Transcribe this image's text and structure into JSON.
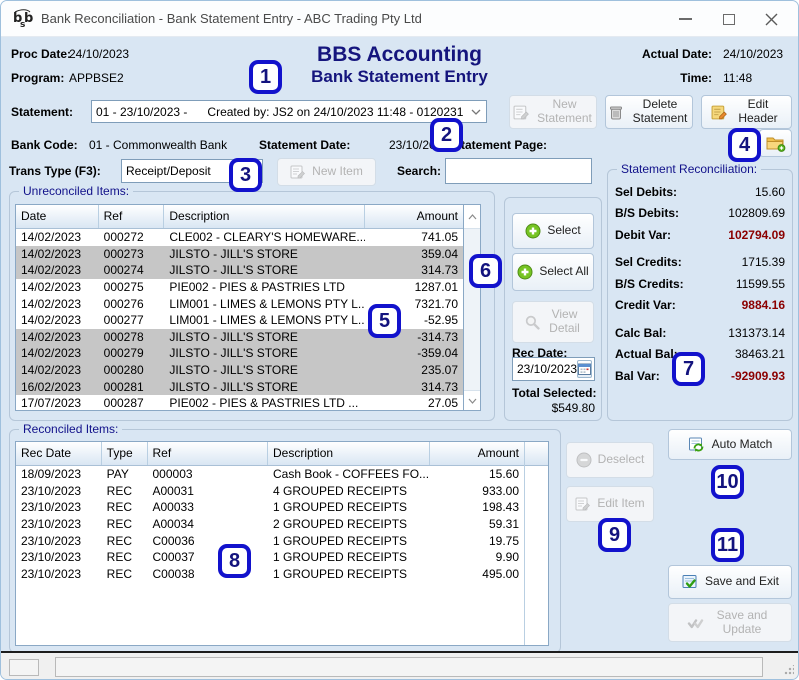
{
  "colors": {
    "accent_navy": "#15157d",
    "alert_red": "#8b0000",
    "selected_row": "#c6c6c6",
    "badge_blue": "#1212cc",
    "window_bg": "#d9e6f3"
  },
  "window": {
    "title": "Bank Reconciliation - Bank Statement Entry - ABC Trading Pty Ltd"
  },
  "header": {
    "proc_date_label": "Proc Date:",
    "proc_date": "24/10/2023",
    "program_label": "Program:",
    "program": "APPBSE2",
    "app_title": "BBS Accounting",
    "screen_title": "Bank Statement Entry",
    "actual_date_label": "Actual Date:",
    "actual_date": "24/10/2023",
    "time_label": "Time:",
    "time": "11:48"
  },
  "statement": {
    "label": "Statement:",
    "value": "01 - 23/10/2023 -      Created by: JS2 on 24/10/2023 11:48 - 0120231",
    "new_button": "New Statement",
    "delete_button": "Delete Statement",
    "edit_button": "Edit Header"
  },
  "bank": {
    "bank_code_label": "Bank Code:",
    "bank_code": "01 - Commonwealth Bank",
    "statement_date_label": "Statement Date:",
    "statement_date": "23/10/2023",
    "statement_page_label": "Statement Page:",
    "statement_page": ""
  },
  "trans": {
    "label": "Trans Type (F3):",
    "value": "Receipt/Deposit",
    "new_item_button": "New Item",
    "search_label": "Search:",
    "search_value": ""
  },
  "unreconciled": {
    "title": "Unreconciled Items:",
    "columns": {
      "date": "Date",
      "ref": "Ref",
      "desc": "Description",
      "amount": "Amount"
    },
    "rows": [
      {
        "date": "14/02/2023",
        "ref": "000272",
        "desc": "CLE002 - CLEARY'S HOMEWARE...",
        "amount": "741.05",
        "sel": false
      },
      {
        "date": "14/02/2023",
        "ref": "000273",
        "desc": "JILSTO - JILL'S STORE",
        "amount": "359.04",
        "sel": true
      },
      {
        "date": "14/02/2023",
        "ref": "000274",
        "desc": "JILSTO - JILL'S STORE",
        "amount": "314.73",
        "sel": true
      },
      {
        "date": "14/02/2023",
        "ref": "000275",
        "desc": "PIE002 - PIES & PASTRIES LTD",
        "amount": "1287.01",
        "sel": false
      },
      {
        "date": "14/02/2023",
        "ref": "000276",
        "desc": "LIM001 - LIMES & LEMONS PTY L...",
        "amount": "7321.70",
        "sel": false
      },
      {
        "date": "14/02/2023",
        "ref": "000277",
        "desc": "LIM001 - LIMES & LEMONS PTY L...",
        "amount": "-52.95",
        "sel": false
      },
      {
        "date": "14/02/2023",
        "ref": "000278",
        "desc": "JILSTO - JILL'S STORE",
        "amount": "-314.73",
        "sel": true
      },
      {
        "date": "14/02/2023",
        "ref": "000279",
        "desc": "JILSTO - JILL'S STORE",
        "amount": "-359.04",
        "sel": true
      },
      {
        "date": "14/02/2023",
        "ref": "000280",
        "desc": "JILSTO - JILL'S STORE",
        "amount": "235.07",
        "sel": true
      },
      {
        "date": "16/02/2023",
        "ref": "000281",
        "desc": "JILSTO - JILL'S STORE",
        "amount": "314.73",
        "sel": true
      },
      {
        "date": "17/07/2023",
        "ref": "000287",
        "desc": "PIE002 - PIES & PASTRIES LTD ...",
        "amount": "27.05",
        "sel": false
      }
    ]
  },
  "actions": {
    "select": "Select",
    "select_all": "Select All",
    "view_detail": "View Detail",
    "rec_date_label": "Rec Date:",
    "rec_date": "23/10/2023",
    "total_selected_label": "Total Selected:",
    "total_selected": "$549.80"
  },
  "reconciliation": {
    "title": "Statement Reconciliation:",
    "rows": [
      {
        "label": "Sel Debits:",
        "value": "15.60",
        "red": false,
        "gap": false
      },
      {
        "label": "B/S Debits:",
        "value": "102809.69",
        "red": false,
        "gap": false
      },
      {
        "label": "Debit Var:",
        "value": "102794.09",
        "red": true,
        "gap": false
      },
      {
        "label": "Sel Credits:",
        "value": "1715.39",
        "red": false,
        "gap": true
      },
      {
        "label": "B/S Credits:",
        "value": "11599.55",
        "red": false,
        "gap": false
      },
      {
        "label": "Credit Var:",
        "value": "9884.16",
        "red": true,
        "gap": false
      },
      {
        "label": "Calc Bal:",
        "value": "131373.14",
        "red": false,
        "gap": true
      },
      {
        "label": "Actual Bal:",
        "value": "38463.21",
        "red": false,
        "gap": false
      },
      {
        "label": "Bal Var:",
        "value": "-92909.93",
        "red": true,
        "gap": false
      }
    ]
  },
  "reconciled": {
    "title": "Reconciled Items:",
    "columns": {
      "rec_date": "Rec Date",
      "type": "Type",
      "ref": "Ref",
      "desc": "Description",
      "amount": "Amount"
    },
    "rows": [
      {
        "rec_date": "18/09/2023",
        "type": "PAY",
        "ref": "000003",
        "desc": "Cash Book - COFFEES FO...",
        "amount": "15.60"
      },
      {
        "rec_date": "23/10/2023",
        "type": "REC",
        "ref": "A00031",
        "desc": "4 GROUPED RECEIPTS",
        "amount": "933.00"
      },
      {
        "rec_date": "23/10/2023",
        "type": "REC",
        "ref": "A00033",
        "desc": "1 GROUPED RECEIPTS",
        "amount": "198.43"
      },
      {
        "rec_date": "23/10/2023",
        "type": "REC",
        "ref": "A00034",
        "desc": "2 GROUPED RECEIPTS",
        "amount": "59.31"
      },
      {
        "rec_date": "23/10/2023",
        "type": "REC",
        "ref": "C00036",
        "desc": "1 GROUPED RECEIPTS",
        "amount": "19.75"
      },
      {
        "rec_date": "23/10/2023",
        "type": "REC",
        "ref": "C00037",
        "desc": "1 GROUPED RECEIPTS",
        "amount": "9.90"
      },
      {
        "rec_date": "23/10/2023",
        "type": "REC",
        "ref": "C00038",
        "desc": "1 GROUPED RECEIPTS",
        "amount": "495.00"
      }
    ]
  },
  "side_buttons": {
    "deselect": "Deselect",
    "edit_item": "Edit Item",
    "auto_match": "Auto Match",
    "save_exit": "Save and Exit",
    "save_update": "Save and Update"
  },
  "badges": [
    "1",
    "2",
    "3",
    "4",
    "5",
    "6",
    "7",
    "8",
    "9",
    "10",
    "11"
  ]
}
